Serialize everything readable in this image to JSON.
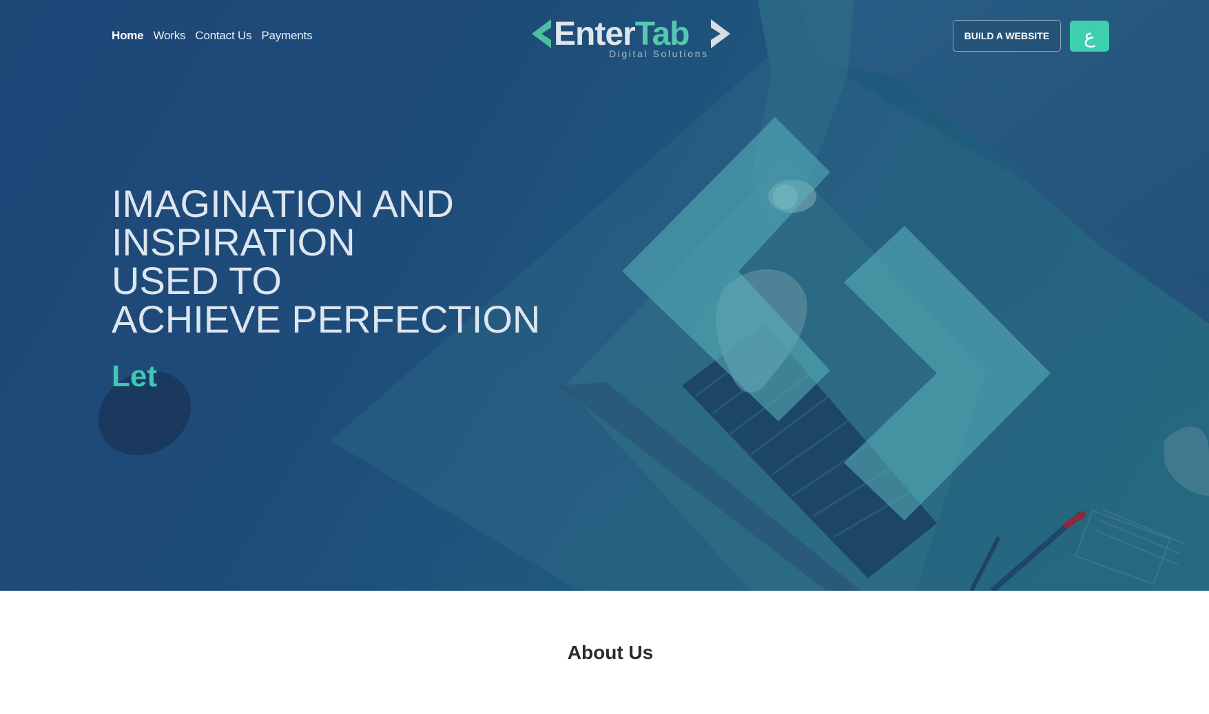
{
  "nav": {
    "items": [
      {
        "label": "Home",
        "active": true
      },
      {
        "label": "Works",
        "active": false
      },
      {
        "label": "Contact Us",
        "active": false
      },
      {
        "label": "Payments",
        "active": false
      }
    ]
  },
  "logo": {
    "part1": "Enter",
    "part2": "Tab",
    "tagline": "Digital  Solutions"
  },
  "header": {
    "build_button": "BUILD A WEBSITE",
    "language_button": "ع"
  },
  "hero": {
    "headline_lines": [
      "IMAGINATION AND",
      "INSPIRATION",
      "USED TO",
      "ACHIEVE PERFECTION"
    ],
    "typed_text": "Let"
  },
  "about": {
    "title": "About Us"
  },
  "colors": {
    "accent": "#3ecfb0",
    "hero_overlay": "#1e4c7a",
    "logo_green": "#57c7b0"
  }
}
